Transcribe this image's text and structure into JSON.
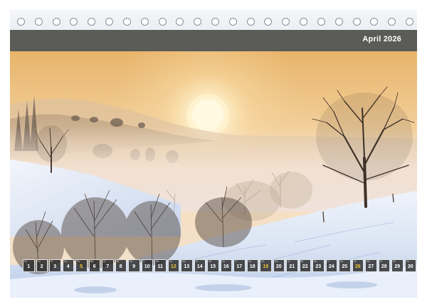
{
  "calendar": {
    "month_title": "April 2026",
    "accent_weekend_color": "#f2c531",
    "header_color": "#5b5b58",
    "spiral_hole_count": 23,
    "days": [
      {
        "wd": "Mi",
        "num": "1",
        "weekend": false
      },
      {
        "wd": "Do",
        "num": "2",
        "weekend": false
      },
      {
        "wd": "Fr",
        "num": "3",
        "weekend": false
      },
      {
        "wd": "Sa",
        "num": "4",
        "weekend": false
      },
      {
        "wd": "So",
        "num": "5",
        "weekend": true
      },
      {
        "wd": "Mo",
        "num": "6",
        "weekend": false
      },
      {
        "wd": "Di",
        "num": "7",
        "weekend": false
      },
      {
        "wd": "Mi",
        "num": "8",
        "weekend": false
      },
      {
        "wd": "Do",
        "num": "9",
        "weekend": false
      },
      {
        "wd": "Fr",
        "num": "10",
        "weekend": false
      },
      {
        "wd": "Sa",
        "num": "11",
        "weekend": false
      },
      {
        "wd": "So",
        "num": "12",
        "weekend": true
      },
      {
        "wd": "Mo",
        "num": "13",
        "weekend": false
      },
      {
        "wd": "Di",
        "num": "14",
        "weekend": false
      },
      {
        "wd": "Mi",
        "num": "15",
        "weekend": false
      },
      {
        "wd": "Do",
        "num": "16",
        "weekend": false
      },
      {
        "wd": "Fr",
        "num": "17",
        "weekend": false
      },
      {
        "wd": "Sa",
        "num": "18",
        "weekend": false
      },
      {
        "wd": "So",
        "num": "19",
        "weekend": true
      },
      {
        "wd": "Mo",
        "num": "20",
        "weekend": false
      },
      {
        "wd": "Di",
        "num": "21",
        "weekend": false
      },
      {
        "wd": "Mi",
        "num": "22",
        "weekend": false
      },
      {
        "wd": "Do",
        "num": "23",
        "weekend": false
      },
      {
        "wd": "Fr",
        "num": "24",
        "weekend": false
      },
      {
        "wd": "Sa",
        "num": "25",
        "weekend": false
      },
      {
        "wd": "So",
        "num": "26",
        "weekend": true
      },
      {
        "wd": "Mo",
        "num": "27",
        "weekend": false
      },
      {
        "wd": "Di",
        "num": "28",
        "weekend": false
      },
      {
        "wd": "Mi",
        "num": "29",
        "weekend": false
      },
      {
        "wd": "Do",
        "num": "30",
        "weekend": false
      }
    ]
  },
  "photo": {
    "subject": "winter-sunrise-landscape",
    "sky_top_color": "#f0c98a",
    "sun_color": "#fff6d8",
    "snow_color": "#e9f0fb",
    "shadow_color": "#9fb4d8"
  }
}
